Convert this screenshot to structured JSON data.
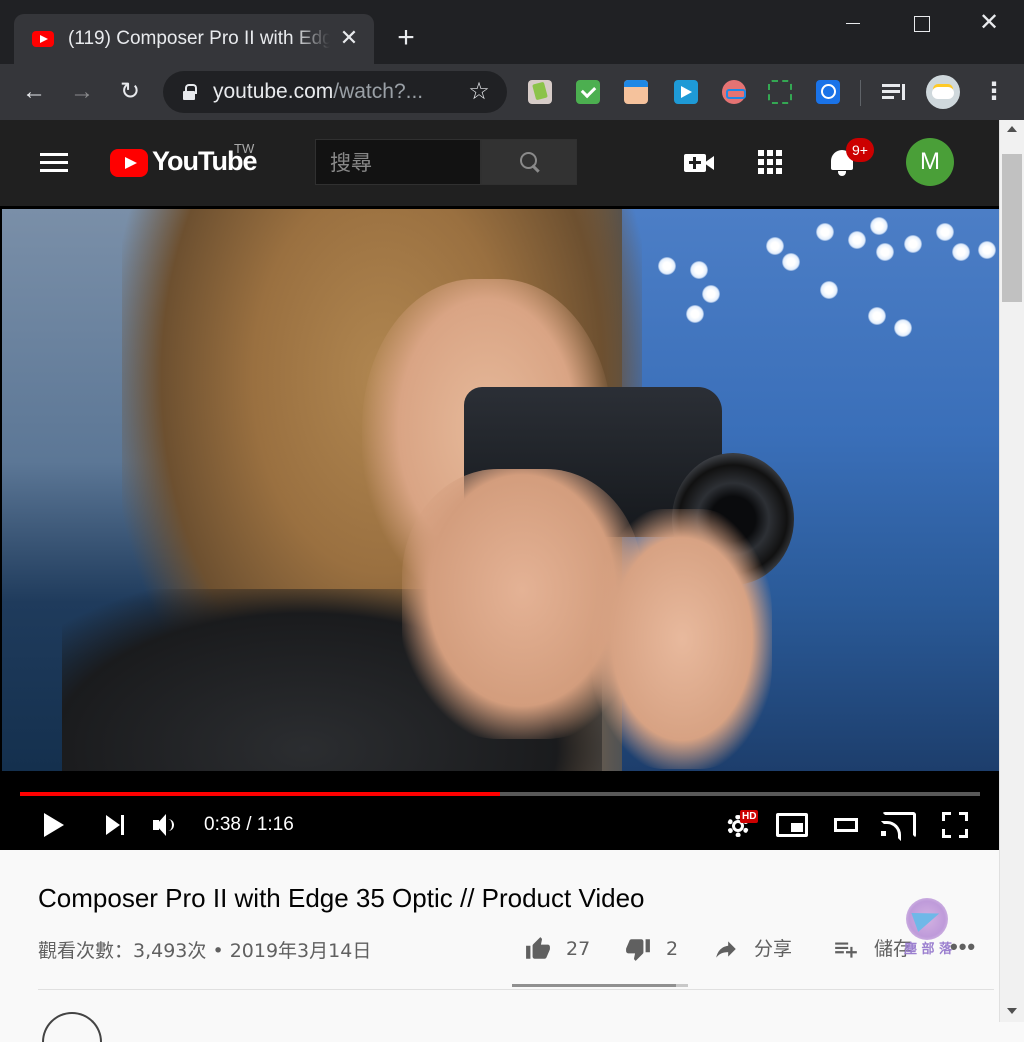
{
  "browser": {
    "tab": {
      "title": "(119) Composer Pro II with Edge 35 Optic // Product Video",
      "favicon": "youtube-favicon-icon"
    },
    "new_tab_symbol": "+",
    "window_controls": {
      "close_symbol": "✕"
    },
    "toolbar": {
      "back_symbol": "←",
      "forward_symbol": "→",
      "reload_symbol": "↻",
      "url_host": "youtube.com",
      "url_path": "/watch?...",
      "bookmark_symbol": "☆",
      "menu_symbol": "⋮",
      "extensions": [
        "evernote-clipper-icon",
        "todo-check-icon",
        "box-face-icon",
        "arrow-forward-ext-icon",
        "glasses-face-icon",
        "screenshot-frame-icon",
        "zoom-search-ext-icon"
      ]
    }
  },
  "youtube": {
    "logo_text": "YouTube",
    "region": "TW",
    "search": {
      "placeholder": "搜尋"
    },
    "notifications": {
      "badge": "9+"
    },
    "user": {
      "initial": "M",
      "color": "#4a9f38"
    }
  },
  "player": {
    "current_time": "0:38",
    "duration": "1:16",
    "time_separator": " / ",
    "progress_fraction": 0.5,
    "settings_badge": "HD",
    "accent": "#ff0000"
  },
  "video": {
    "title": "Composer Pro II with Edge 35 Optic // Product Video",
    "views": "觀看次數：3,493次",
    "meta_separator": " • ",
    "date": "2019年3月14日",
    "likes": "27",
    "dislikes": "2",
    "like_fraction": 0.93,
    "share_label": "分享",
    "save_label": "儲存",
    "more_symbol": "•••"
  },
  "watermark": {
    "text": "塵 部 落"
  }
}
